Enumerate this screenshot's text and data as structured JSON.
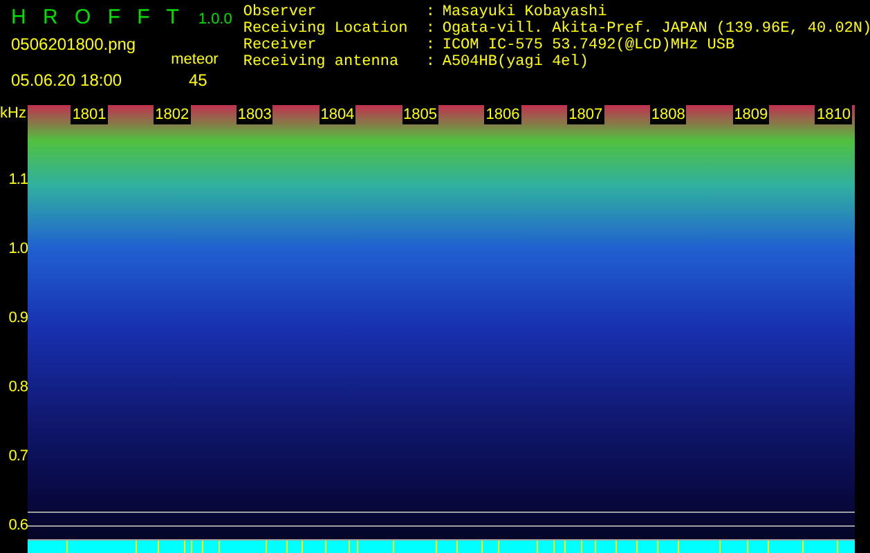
{
  "app": {
    "title": "H R O F F T",
    "version": "1.0.0"
  },
  "file": "0506201800.png",
  "datetime": "05.06.20 18:00",
  "meteor": {
    "label": "meteor",
    "count": "45"
  },
  "info": [
    {
      "label": "Observer",
      "separator": ":",
      "value": "Masayuki Kobayashi"
    },
    {
      "label": "Receiving Location",
      "separator": ":",
      "value": "Ogata-vill. Akita-Pref. JAPAN (139.96E, 40.02N)"
    },
    {
      "label": "Receiver",
      "separator": ":",
      "value": "ICOM IC-575 53.7492(@LCD)MHz USB"
    },
    {
      "label": "Receiving antenna",
      "separator": ":",
      "value": "A504HB(yagi 4el)"
    }
  ],
  "spectrogram": {
    "unit": "kHz",
    "time_labels": [
      "1801",
      "1802",
      "1803",
      "1804",
      "1805",
      "1806",
      "1807",
      "1808",
      "1809",
      "1810"
    ],
    "freq_labels": [
      "1.1",
      "1.0",
      "0.9",
      "0.8",
      "0.7",
      "0.6"
    ]
  }
}
